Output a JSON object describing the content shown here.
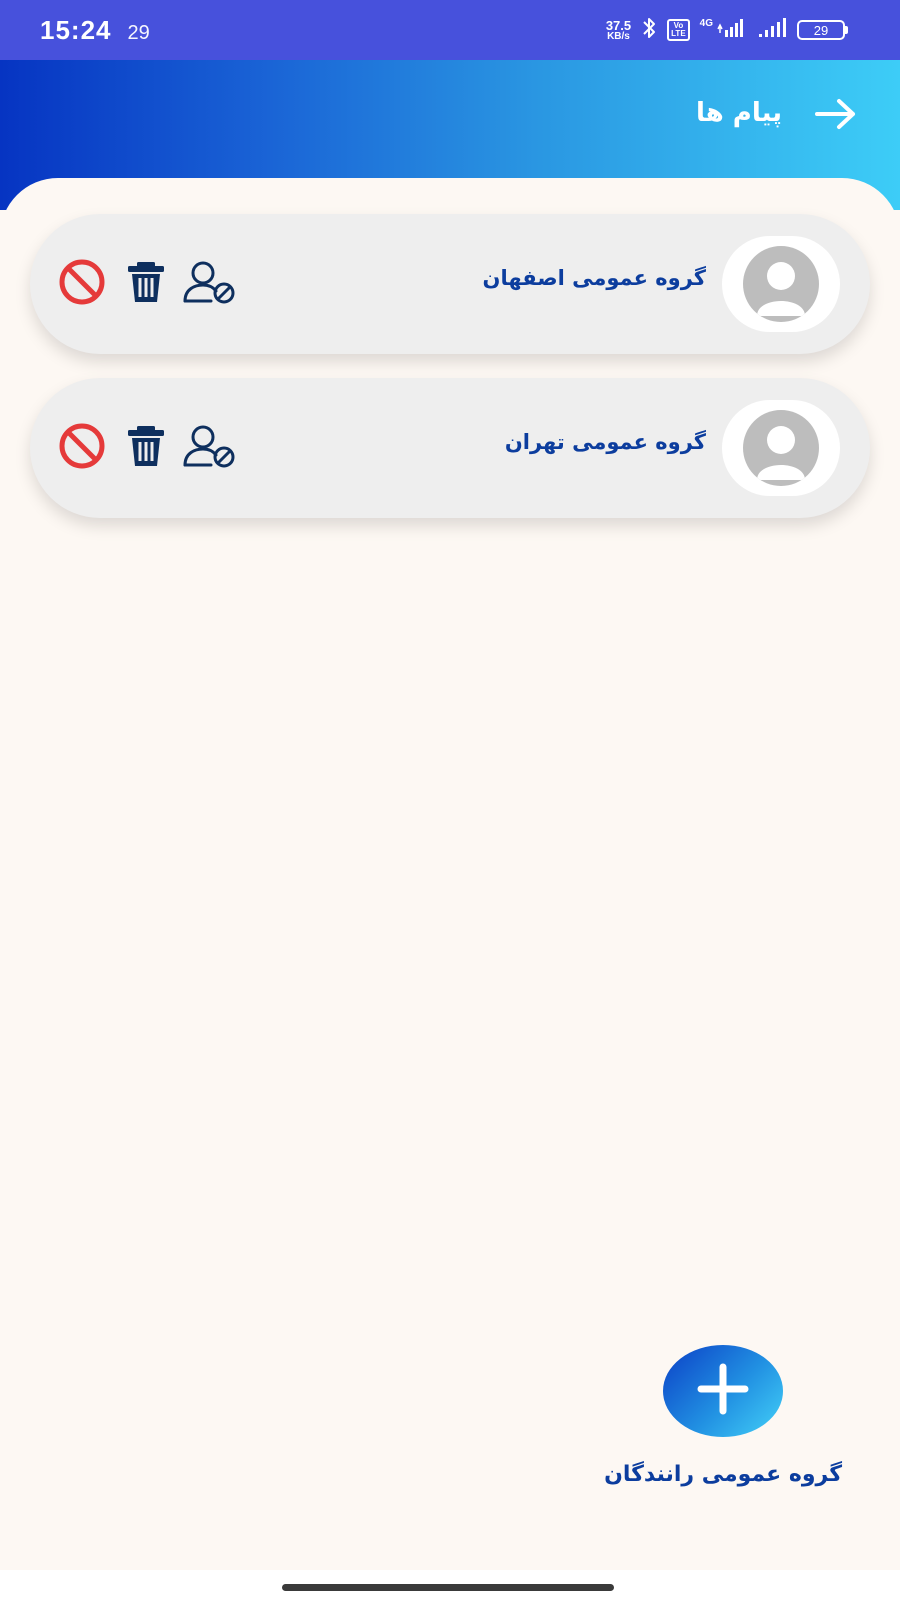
{
  "status_bar": {
    "time": "15:24",
    "notification_count": "29",
    "net_speed_value": "37.5",
    "net_speed_unit": "KB/s",
    "volte_line1": "Vo",
    "volte_line2": "LTE",
    "network_type": "4G",
    "battery_level": "29"
  },
  "header": {
    "title": "پیام ها",
    "back_icon": "arrow-right-icon",
    "gradient_colors": [
      "#0634c2",
      "#3dcdf7"
    ]
  },
  "groups": [
    {
      "name": "گروه عمومی اصفهان",
      "avatar_icon": "default-avatar-icon",
      "actions": [
        "block-user-icon",
        "delete-icon",
        "ban-icon"
      ]
    },
    {
      "name": "گروه عمومی تهران",
      "avatar_icon": "default-avatar-icon",
      "actions": [
        "block-user-icon",
        "delete-icon",
        "ban-icon"
      ]
    }
  ],
  "fab": {
    "icon": "plus-icon",
    "label": "گروه عمومی رانندگان"
  },
  "colors": {
    "status_bar": "#4751dc",
    "text_primary": "#0c3d9e",
    "icon_dark": "#0e2f5e",
    "ban_red": "#e53a3a",
    "card_bg": "#eeeeee",
    "page_bg": "#fdf8f3"
  }
}
